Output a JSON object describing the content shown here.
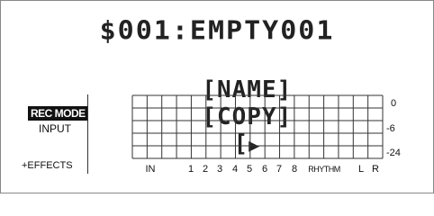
{
  "display": {
    "title": "$001:EMPTY001",
    "menu": {
      "name_label": "[NAME]",
      "copy_label": "[COPY]",
      "more_label": "[",
      "more_arrow": "▶"
    }
  },
  "side_panel": {
    "rec_mode": "REC MODE",
    "input": "INPUT",
    "effects": "+EFFECTS"
  },
  "meter": {
    "db_scale": [
      "0",
      "-6",
      "-24"
    ],
    "channels": [
      "IN",
      "1",
      "2",
      "3",
      "4",
      "5",
      "6",
      "7",
      "8",
      "RHYTHM",
      "L",
      "R"
    ],
    "levels": [
      0,
      0,
      0,
      0,
      0,
      0,
      0,
      0,
      0,
      0,
      0,
      0
    ]
  },
  "colors": {
    "lcd_text": "#222222",
    "grid": "#333333",
    "highlight_bg": "#111111",
    "highlight_fg": "#ffffff"
  }
}
